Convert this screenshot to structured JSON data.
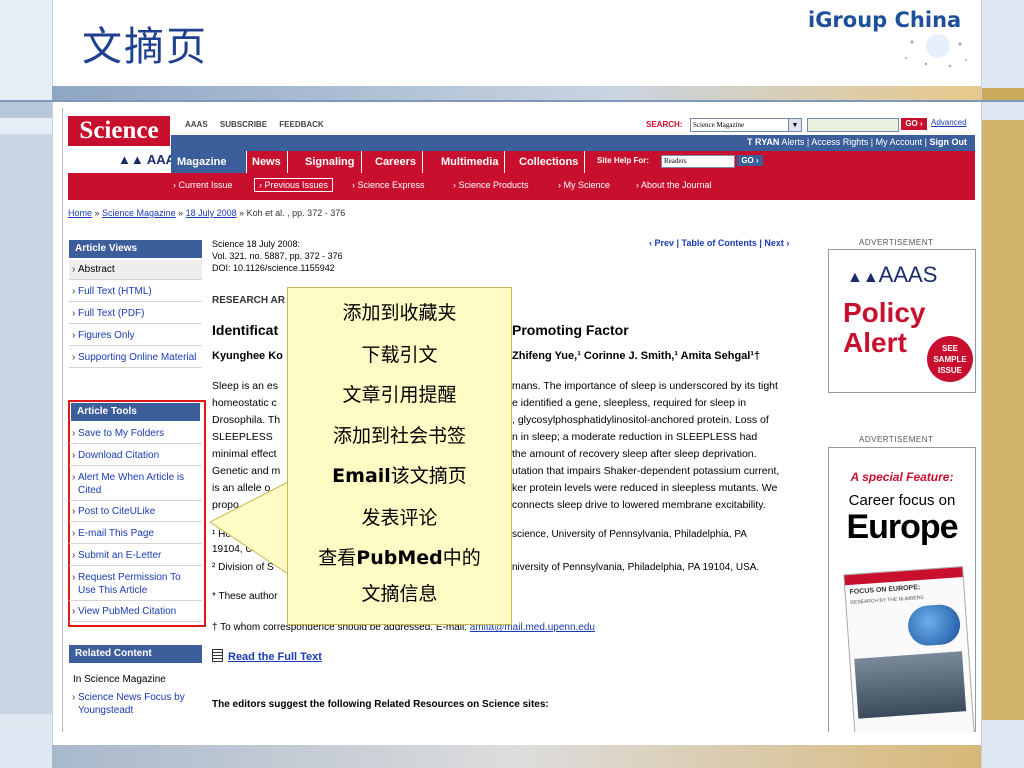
{
  "slide": {
    "title": "文摘页",
    "brand": "iGroup China"
  },
  "site": {
    "logo_text": "Science",
    "aaas_text": "AAAS",
    "top_links": [
      "AAAS",
      "SUBSCRIBE",
      "FEEDBACK"
    ],
    "search": {
      "label": "SEARCH:",
      "scope": "Science Magazine",
      "go": "GO ›",
      "advanced": "Advanced"
    },
    "user_bar": {
      "user": "T RYAN",
      "links": "Alerts | Access Rights | My Account |",
      "sign_out": "Sign Out"
    },
    "nav": [
      "Magazine",
      "News",
      "Signaling",
      "Careers",
      "Multimedia",
      "Collections"
    ],
    "site_help": {
      "label": "Site Help For:",
      "value": "Readers",
      "go": "GO ›"
    },
    "sub_nav": [
      "Current Issue",
      "Previous Issues",
      "Science Express",
      "Science Products",
      "My Science",
      "About the Journal"
    ]
  },
  "breadcrumb": {
    "home": "Home",
    "sep1": " » ",
    "magazine": "Science Magazine",
    "sep2": " » ",
    "issue": "18 July 2008",
    "rest": " » Koh et al. , pp. 372 - 376"
  },
  "article_views": {
    "header": "Article Views",
    "items": [
      "Abstract",
      "Full Text (HTML)",
      "Full Text (PDF)",
      "Figures Only",
      "Supporting Online Material"
    ]
  },
  "article_tools": {
    "header": "Article Tools",
    "items": [
      "Save to My Folders",
      "Download Citation",
      "Alert Me When Article is Cited",
      "Post to CiteULike",
      "E-mail This Page",
      "Submit an E-Letter",
      "Request Permission To Use This Article",
      "View PubMed Citation"
    ]
  },
  "related": {
    "header": "Related Content",
    "in_label": "In Science Magazine",
    "item": "Science News Focus by Youngsteadt"
  },
  "article": {
    "journal_line": "Science 18 July 2008:",
    "volume_line": "Vol. 321. no. 5887, pp. 372 - 376",
    "doi_line": "DOI: 10.1126/science.1155942",
    "nav": "‹ Prev | Table of Contents | Next ›",
    "section": "RESEARCH AR",
    "title_left": "Identificat",
    "title_right": "Promoting Factor",
    "authors_left": "Kyunghee Ko",
    "authors_right": "Zhifeng Yue,¹ Corinne J. Smith,¹ Amita Sehgal¹†",
    "abstract_lines": [
      {
        "l": "Sleep is an es",
        "r": "mans. The importance of sleep is underscored by its tight"
      },
      {
        "l": "homeostatic c",
        "r": "e identified a gene, sleepless, required for sleep in"
      },
      {
        "l": "Drosophila. Th",
        "r": ", glycosylphosphatidylinositol-anchored protein. Loss of"
      },
      {
        "l": "SLEEPLESS",
        "r": "n in sleep; a moderate reduction in SLEEPLESS had"
      },
      {
        "l": "minimal effect",
        "r": "the amount of recovery sleep after sleep deprivation."
      },
      {
        "l": "Genetic and m",
        "r": "utation that impairs Shaker-dependent potassium current,"
      },
      {
        "l": "is an allele o",
        "r": "ker protein levels were reduced in sleepless mutants. We"
      },
      {
        "l": "propo",
        "r": "connects sleep drive to lowered membrane excitability."
      }
    ],
    "affil1_left": "¹ Ho",
    "affil1_right": "science, University of Pennsylvania, Philadelphia, PA",
    "affil1_b": "19104, U",
    "affil2_left": "² Division of S",
    "affil2_right": "niversity of Pennsylvania, Philadelphia, PA 19104, USA.",
    "footnote_star": "* These author",
    "correspondence": "† To whom correspondence should be addressed. E-mail: ",
    "email": "amita@mail.med.upenn.edu",
    "read_full": "Read the Full Text",
    "editors": "The editors suggest the following Related Resources on Science sites:"
  },
  "ads": {
    "label": "ADVERTISEMENT",
    "ad1": {
      "org": "AAAS",
      "line1": "Policy",
      "line2": "Alert",
      "badge": "SEE SAMPLE ISSUE"
    },
    "ad2": {
      "line1": "A special Feature:",
      "line2": "Career focus on",
      "line3": "Europe",
      "mag_title": "FOCUS ON EUROPE:",
      "mag_sub": "RESEARCH BY THE NUMBERS"
    }
  },
  "callout": {
    "items": [
      "添加到收藏夹",
      "下载引文",
      "文章引用提醒",
      "添加到社会书签"
    ],
    "email_bold": "Email",
    "email_rest": "该文摘页",
    "item6": "发表评论",
    "pubmed_pre": "查看",
    "pubmed_bold": "PubMed",
    "pubmed_post": "中的",
    "last": "文摘信息"
  },
  "colors": {
    "science_red": "#c8102e",
    "nav_blue": "#3c5f9c",
    "link_blue": "#1a3bb3",
    "title_blue": "#1f3f8f",
    "callout_bg": "#fffbc4",
    "highlight_red": "#e01818"
  }
}
